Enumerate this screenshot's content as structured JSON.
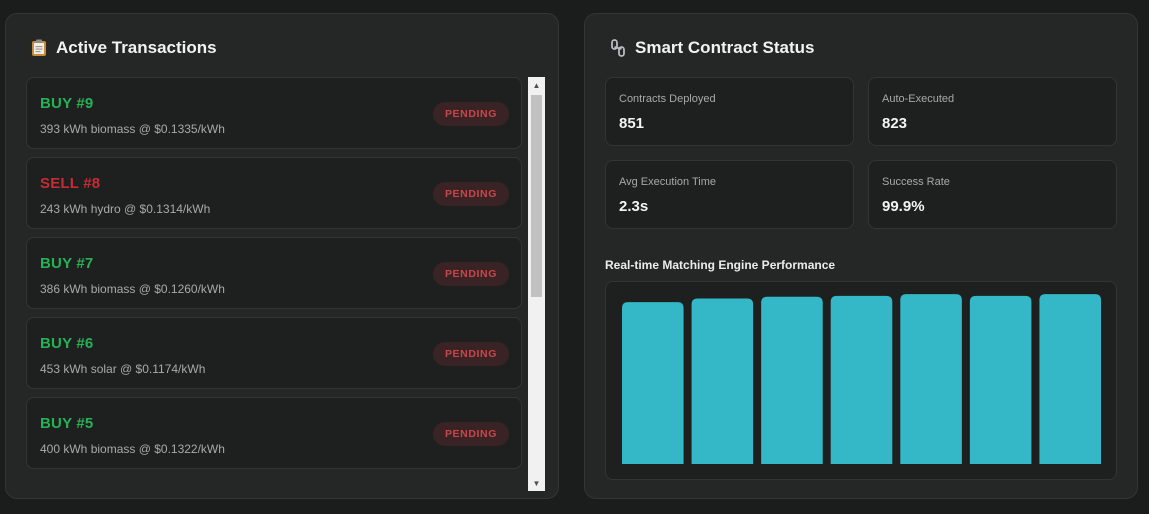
{
  "left": {
    "title": "Active Transactions",
    "title_icon": "clipboard-icon",
    "transactions": [
      {
        "type": "buy",
        "label": "BUY #9",
        "desc": "393 kWh biomass @ $0.1335/kWh",
        "status": "PENDING"
      },
      {
        "type": "sell",
        "label": "SELL #8",
        "desc": "243 kWh hydro @ $0.1314/kWh",
        "status": "PENDING"
      },
      {
        "type": "buy",
        "label": "BUY #7",
        "desc": "386 kWh biomass @ $0.1260/kWh",
        "status": "PENDING"
      },
      {
        "type": "buy",
        "label": "BUY #6",
        "desc": "453 kWh solar @ $0.1174/kWh",
        "status": "PENDING"
      },
      {
        "type": "buy",
        "label": "BUY #5",
        "desc": "400 kWh biomass @ $0.1322/kWh",
        "status": "PENDING"
      }
    ]
  },
  "right": {
    "title": "Smart Contract Status",
    "title_icon": "chain-link-icon",
    "stats": [
      {
        "label": "Contracts Deployed",
        "value": "851"
      },
      {
        "label": "Auto-Executed",
        "value": "823"
      },
      {
        "label": "Avg Execution Time",
        "value": "2.3s"
      },
      {
        "label": "Success Rate",
        "value": "99.9%"
      }
    ],
    "chart_title": "Real-time Matching Engine Performance"
  },
  "colors": {
    "buy": "#27b155",
    "sell": "#c42c36",
    "badge_bg": "#3a2324",
    "badge_text": "#c9454c",
    "bar": "#34b8c8"
  },
  "chart_data": {
    "type": "bar",
    "title": "Real-time Matching Engine Performance",
    "categories": [
      "",
      "",
      "",
      "",
      "",
      "",
      ""
    ],
    "values": [
      0.92,
      0.94,
      0.95,
      0.955,
      0.965,
      0.955,
      0.965
    ],
    "ylim": [
      0,
      1
    ],
    "grid": false,
    "xlabel": "",
    "ylabel": ""
  }
}
